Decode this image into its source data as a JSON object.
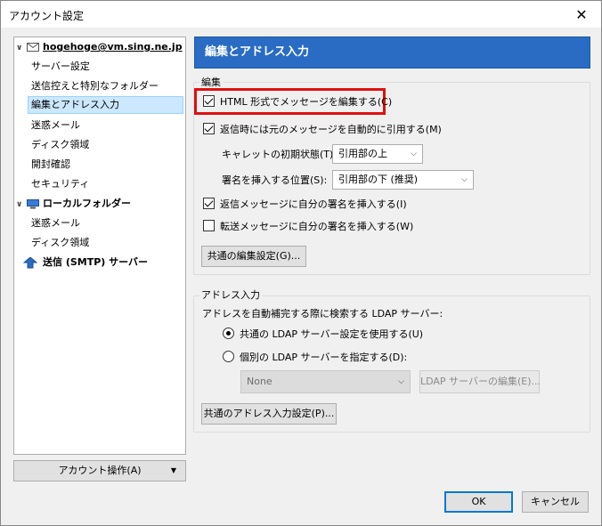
{
  "window": {
    "title": "アカウント設定"
  },
  "sidebar": {
    "account": "hogehoge@vm.sing.ne.jp",
    "items": [
      "サーバー設定",
      "送信控えと特別なフォルダー",
      "編集とアドレス入力",
      "迷惑メール",
      "ディスク領域",
      "開封確認",
      "セキュリティ"
    ],
    "local_folders": "ローカルフォルダー",
    "local_items": [
      "迷惑メール",
      "ディスク領域"
    ],
    "smtp": "送信 (SMTP) サーバー",
    "account_actions": "アカウント操作(A)"
  },
  "panel": {
    "header": "編集とアドレス入力",
    "editing": {
      "group_title": "編集",
      "html_compose": "HTML 形式でメッセージを編集する(C)",
      "auto_quote": "返信時には元のメッセージを自動的に引用する(M)",
      "caret_label": "キャレットの初期状態(T):",
      "caret_value": "引用部の上",
      "signature_label": "署名を挿入する位置(S):",
      "signature_value": "引用部の下 (推奨)",
      "sig_reply": "返信メッセージに自分の署名を挿入する(I)",
      "sig_forward": "転送メッセージに自分の署名を挿入する(W)",
      "global_button": "共通の編集設定(G)..."
    },
    "addressing": {
      "group_title": "アドレス入力",
      "ldap_label": "アドレスを自動補完する際に検索する LDAP サーバー:",
      "use_global": "共通の LDAP サーバー設定を使用する(U)",
      "use_specific": "個別の LDAP サーバーを指定する(D):",
      "ldap_select": "None",
      "edit_ldap": "LDAP サーバーの編集(E)...",
      "global_button": "共通のアドレス入力設定(P)..."
    }
  },
  "footer": {
    "ok": "OK",
    "cancel": "キャンセル"
  }
}
